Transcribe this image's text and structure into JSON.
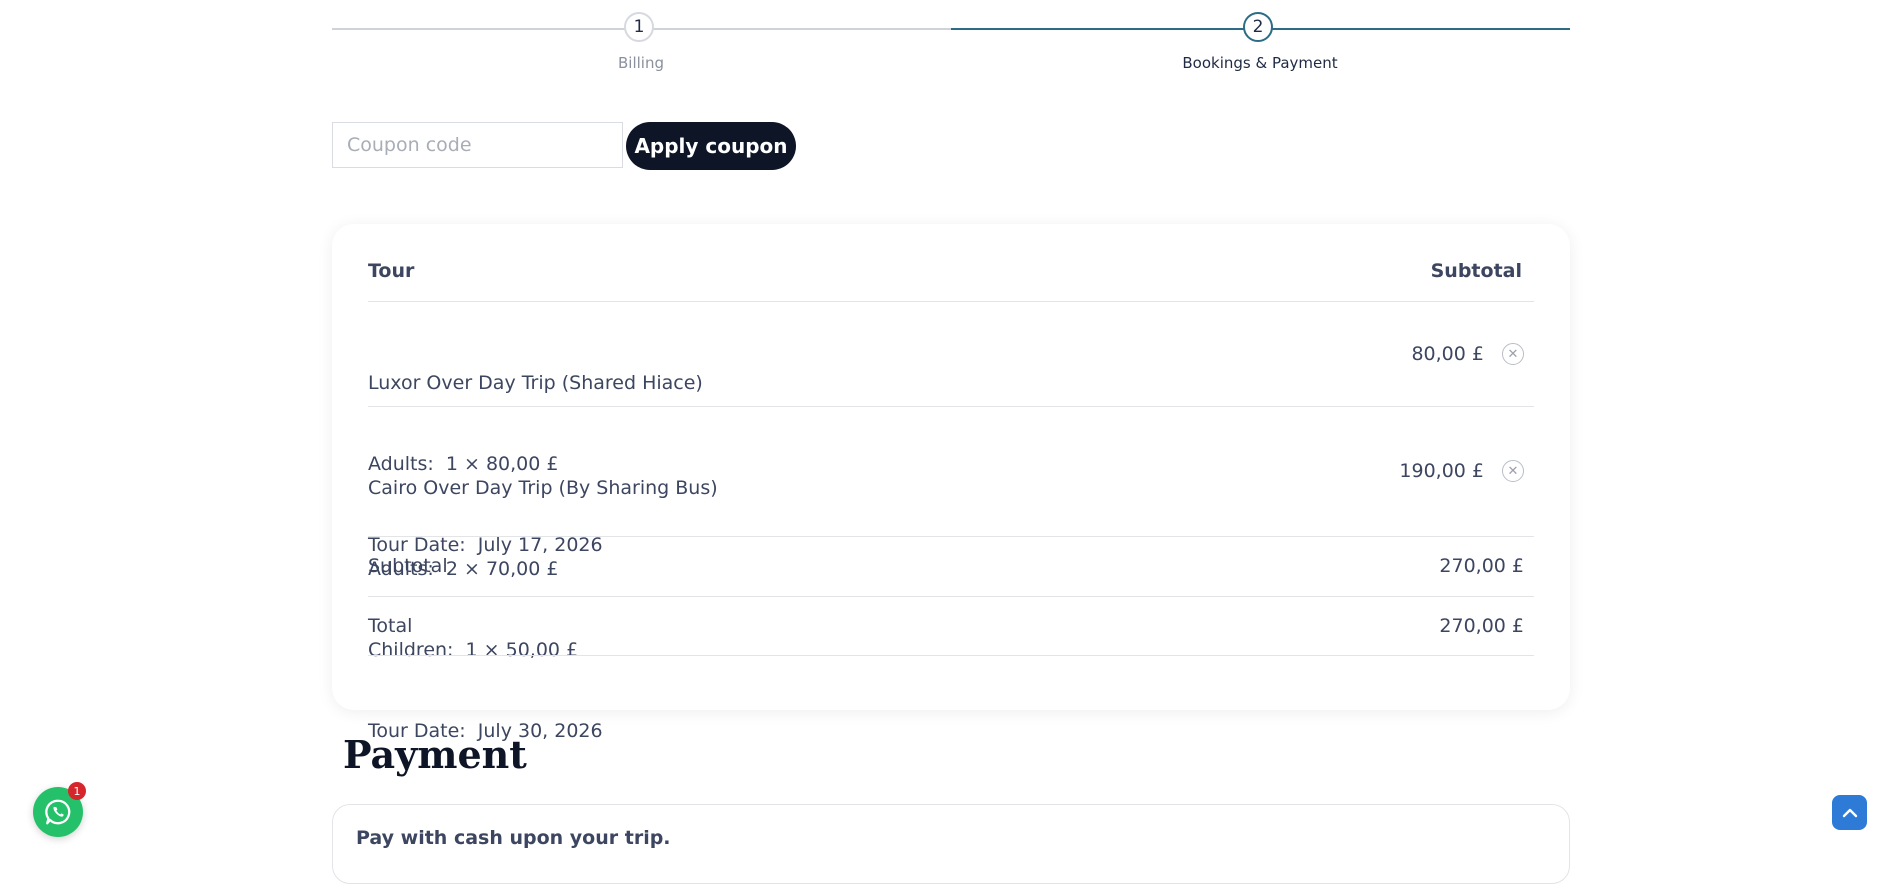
{
  "stepper": {
    "steps": [
      {
        "number": "1",
        "label": "Billing"
      },
      {
        "number": "2",
        "label": "Bookings & Payment"
      }
    ],
    "active_step": 2
  },
  "coupon": {
    "placeholder": "Coupon code",
    "value": "",
    "apply_label": "Apply coupon"
  },
  "order": {
    "headers": {
      "tour": "Tour",
      "subtotal": "Subtotal"
    },
    "items": [
      {
        "lines": [
          "Luxor Over Day Trip (Shared Hiace)",
          "Adults:  1 × 80,00 £",
          "Tour Date:  July 17, 2026"
        ],
        "price": "80,00 £"
      },
      {
        "lines": [
          "Cairo Over Day Trip (By Sharing Bus)",
          "Adults:  2 × 70,00 £",
          "Children:  1 × 50,00 £",
          "Tour Date:  July 30, 2026"
        ],
        "price": "190,00 £"
      }
    ],
    "subtotal_label": "Subtotal",
    "subtotal_value": "270,00 £",
    "total_label": "Total",
    "total_value": "270,00 £"
  },
  "payment": {
    "title": "Payment",
    "method_text": "Pay with cash upon your trip."
  },
  "floating": {
    "whatsapp_badge": "1"
  },
  "colors": {
    "accent": "#2d6c86",
    "button_dark": "#0d1526",
    "whatsapp": "#25c16a",
    "scroll_top": "#2d7bd6"
  }
}
